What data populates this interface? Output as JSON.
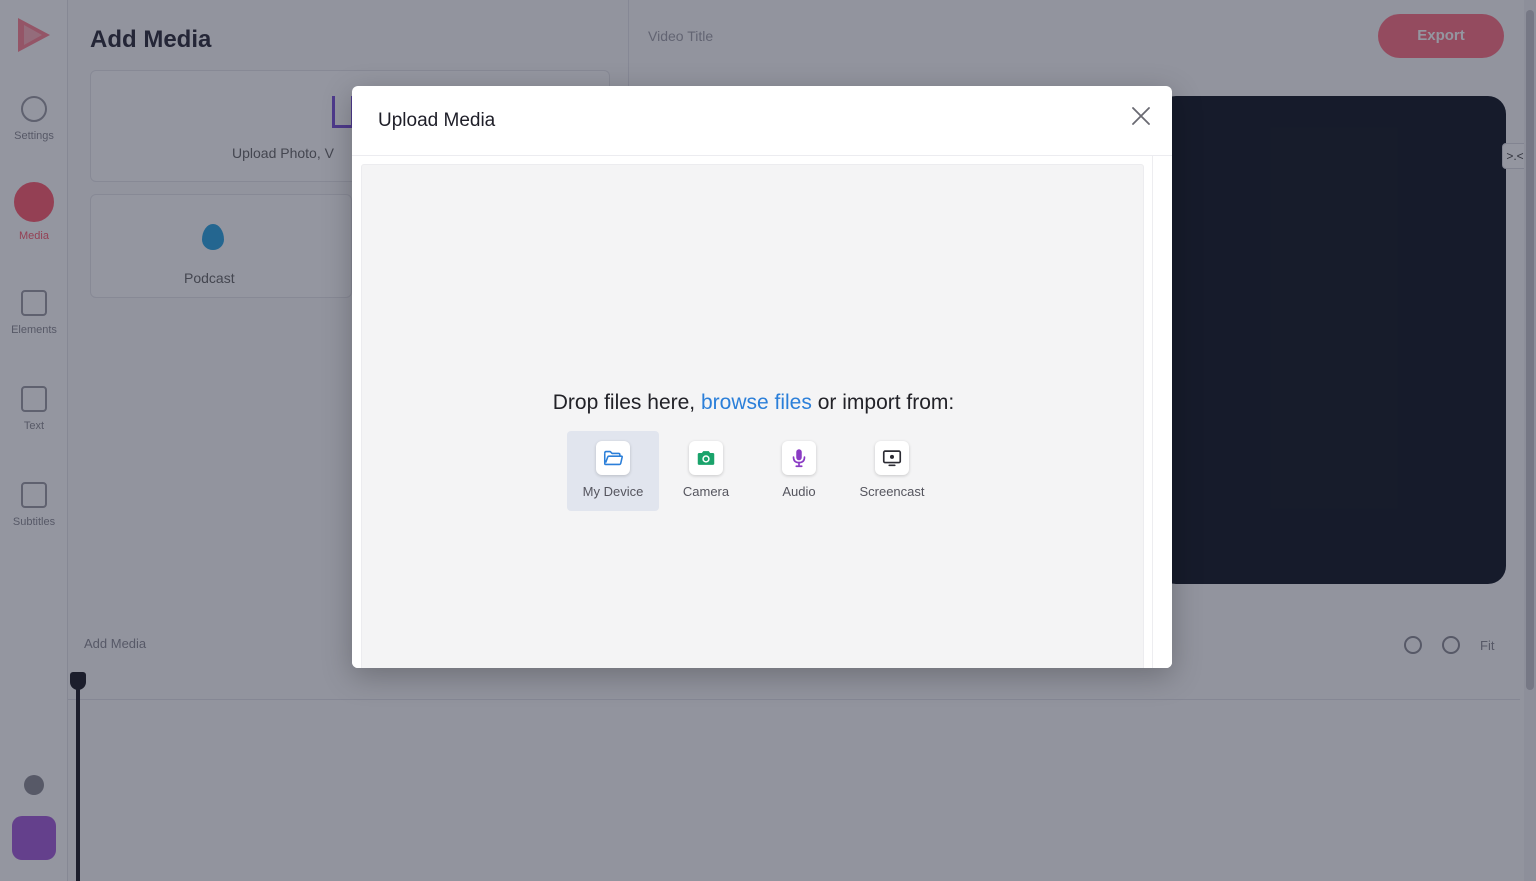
{
  "app": {
    "title": "Add Media",
    "sidebar_items": [
      "Settings",
      "Media",
      "Elements",
      "Text",
      "Subtitles"
    ],
    "panel_upload_label": "Upload Photo, V",
    "panel_podcast_label": "Podcast",
    "video_title_placeholder": "Video Title",
    "export_label": "Export",
    "timeline_add_media": "Add Media",
    "timeline_fit": "Fit",
    "collapse_glyph": ">.<",
    "brand_color": "#ff5a6e"
  },
  "modal": {
    "title": "Upload Media",
    "drop_text_before": "Drop files here,",
    "browse_link": "browse files",
    "drop_text_after": "or import from:",
    "sources": [
      {
        "label": "My Device",
        "icon": "folder-icon",
        "selected": true,
        "color": "#2b7fd9"
      },
      {
        "label": "Camera",
        "icon": "camera-icon",
        "selected": false,
        "color": "#1aa36b"
      },
      {
        "label": "Audio",
        "icon": "microphone-icon",
        "selected": false,
        "color": "#8a3bc4"
      },
      {
        "label": "Screencast",
        "icon": "screencast-icon",
        "selected": false,
        "color": "#2b2b33"
      }
    ]
  }
}
